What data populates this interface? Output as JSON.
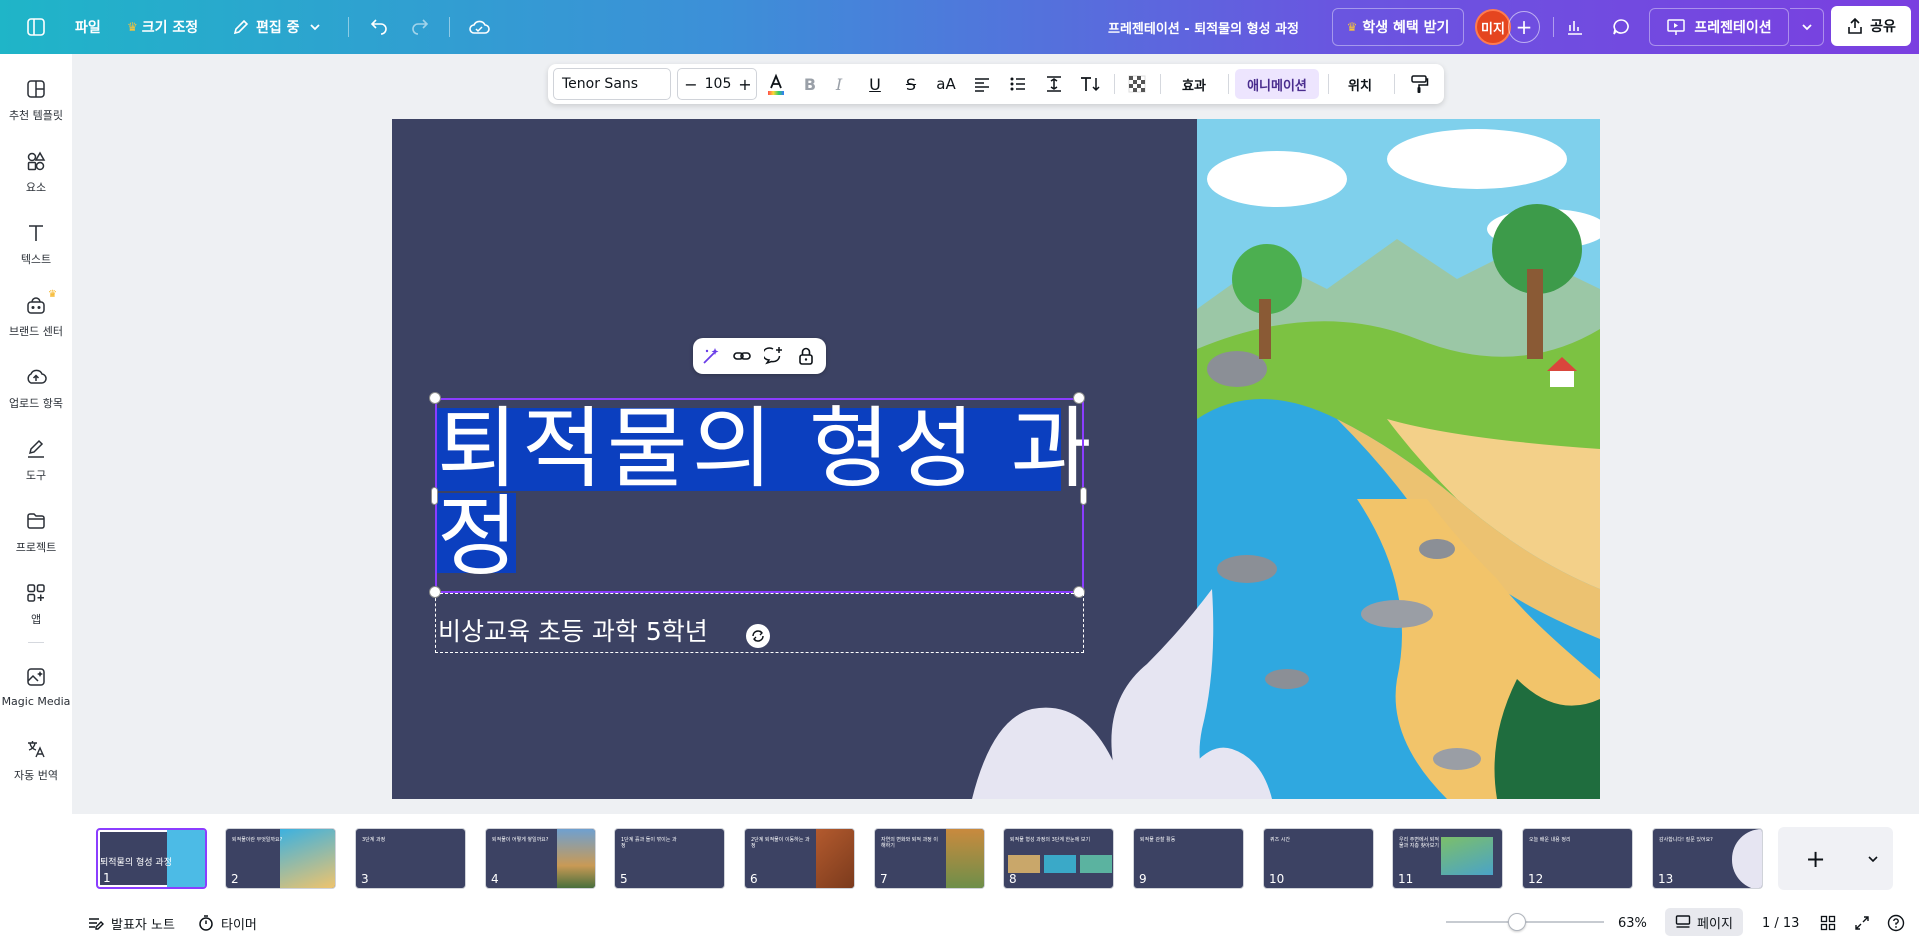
{
  "topbar": {
    "file": "파일",
    "resize": "크기 조정",
    "editing": "편집 중",
    "doc_title": "프레젠테이션 - 퇴적물의 형성 과정",
    "student_benefit": "학생 혜택 받기",
    "avatar": "미지",
    "present": "프레젠테이션",
    "share": "공유"
  },
  "sidebar": {
    "items": [
      {
        "label": "추천 템플릿",
        "icon": "template-icon"
      },
      {
        "label": "요소",
        "icon": "elements-icon"
      },
      {
        "label": "텍스트",
        "icon": "text-icon"
      },
      {
        "label": "브랜드 센터",
        "icon": "brand-icon"
      },
      {
        "label": "업로드 항목",
        "icon": "upload-icon"
      },
      {
        "label": "도구",
        "icon": "draw-icon"
      },
      {
        "label": "프로젝트",
        "icon": "folder-icon"
      },
      {
        "label": "앱",
        "icon": "apps-icon"
      },
      {
        "label": "Magic Media",
        "icon": "magic-media-icon"
      },
      {
        "label": "자동 번역",
        "icon": "translate-icon"
      }
    ]
  },
  "toolbar": {
    "font": "Tenor Sans",
    "font_size": "105",
    "effects": "효과",
    "animation": "애니메이션",
    "position": "위치"
  },
  "slide": {
    "title": "퇴적물의 형성 과정",
    "title_line1": "퇴적물의 형성 과",
    "title_line2": "정",
    "subtitle": "비상교육 초등 과학 5학년"
  },
  "thumbnails": [
    {
      "num": "1",
      "title": "퇴적물의 형성 과정"
    },
    {
      "num": "2",
      "title": "퇴적물이란 무엇일까요?"
    },
    {
      "num": "3",
      "title": "3단계 과정"
    },
    {
      "num": "4",
      "title": "퇴적물이 어떻게 쌓일까요?"
    },
    {
      "num": "5",
      "title": "1단계 흙과 돌이 깎이는 과정"
    },
    {
      "num": "6",
      "title": "2단계 퇴적물이 이동하는 과정"
    },
    {
      "num": "7",
      "title": "자연의 변화와 퇴적 과정 이해하기"
    },
    {
      "num": "8",
      "title": "퇴적물 형성 과정의 3단계 한눈에 보기"
    },
    {
      "num": "9",
      "title": "퇴적물 관찰 활동"
    },
    {
      "num": "10",
      "title": "퀴즈 시간"
    },
    {
      "num": "11",
      "title": "우리 주변에서 퇴적물과 지층 찾아보기"
    },
    {
      "num": "12",
      "title": "오늘 배운 내용 정리"
    },
    {
      "num": "13",
      "title": "감사합니다! 질문 있어요?"
    }
  ],
  "footer": {
    "notes": "발표자 노트",
    "timer": "타이머",
    "zoom": "63%",
    "zoom_value": 0.45,
    "pages_label": "페이지",
    "page_count": "1 / 13"
  },
  "colors": {
    "accent": "#8b3dff",
    "slide_bg": "#3c4263",
    "selection": "#0b3fbf"
  }
}
